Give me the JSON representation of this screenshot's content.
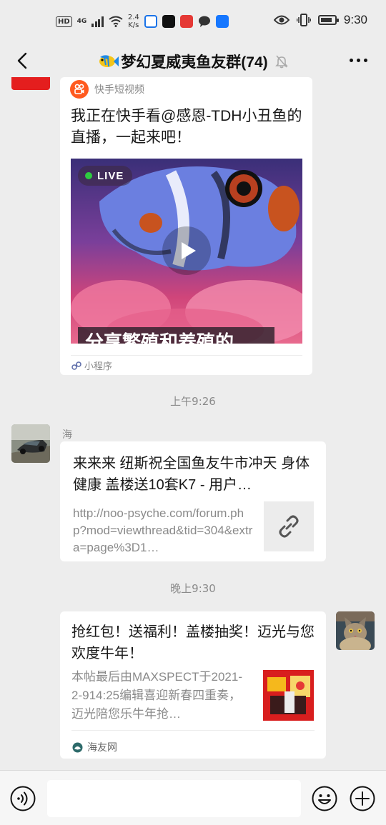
{
  "status_bar": {
    "hd": "HD",
    "network": "4G",
    "speed_value": "2.4",
    "speed_unit": "K/s",
    "time": "9:30",
    "battery_level": 0.85
  },
  "nav": {
    "title": "梦幻夏威夷鱼友群(74)"
  },
  "messages": {
    "kuaishou_card": {
      "source": "快手短视频",
      "text": "我正在快手看@感恩-TDH小丑鱼的直播，一起来吧！",
      "live_label": "LIVE",
      "caption": "分享繁殖和养殖的",
      "mini_program_label": "小程序"
    },
    "timestamp1": "上午9:26",
    "link_message": {
      "sender": "海",
      "title": "来来来 纽斯祝全国鱼友牛市冲天 身体健康 盖楼送10套K7 - 用户…",
      "url": "http://noo-psyche.com/forum.php?mod=viewthread&tid=304&extra=page%3D1…"
    },
    "timestamp2": "晚上9:30",
    "my_card": {
      "title": "抢红包！送福利！盖楼抽奖！迈光与您欢度牛年！",
      "description": "本帖最后由MAXSPECT于2021-2-914:25编辑喜迎新春四重奏，迈光陪您乐牛年抢…",
      "source": "海友网"
    }
  },
  "input": {
    "placeholder": ""
  },
  "colors": {
    "background": "#ededed",
    "card": "#ffffff",
    "kuaishou_orange": "#ff5a1f",
    "live_green": "#2ecc40"
  }
}
